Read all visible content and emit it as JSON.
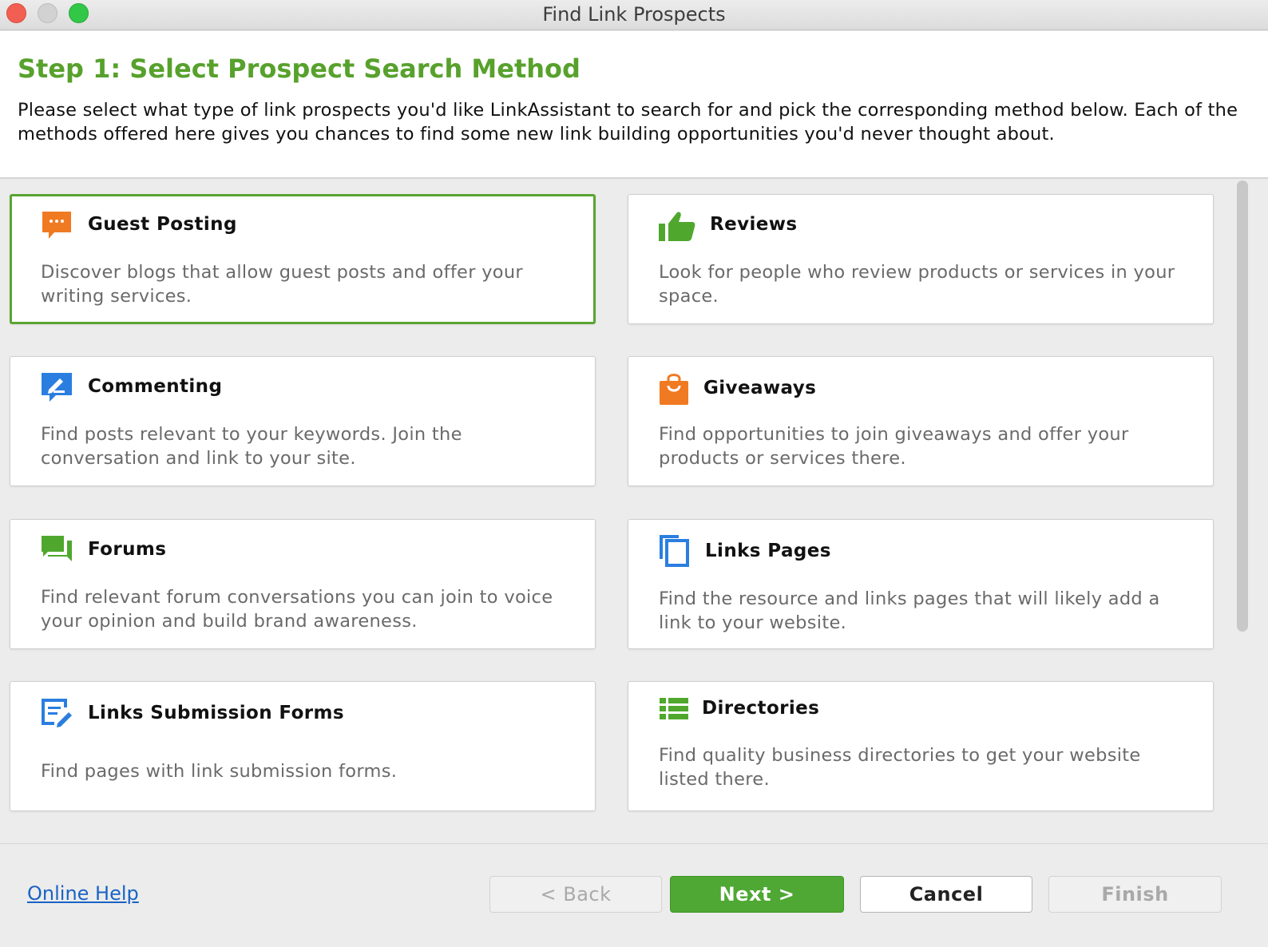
{
  "window": {
    "title": "Find Link Prospects"
  },
  "header": {
    "step_title": "Step 1: Select Prospect Search Method",
    "description": "Please select what type of link prospects you'd like LinkAssistant to search for and pick the corresponding method below. Each of the methods offered here gives you chances to find some new link building opportunities you'd never thought about."
  },
  "methods": [
    {
      "title": "Guest Posting",
      "description": "Discover blogs that allow guest posts and offer your writing services.",
      "icon": "speech-bubble-icon",
      "color": "#f07a22",
      "selected": true
    },
    {
      "title": "Reviews",
      "description": "Look for people who review products or services in your space.",
      "icon": "thumbs-up-icon",
      "color": "#4fa82d",
      "selected": false
    },
    {
      "title": "Commenting",
      "description": "Find posts relevant to your keywords. Join the conversation and link to your site.",
      "icon": "comment-pencil-icon",
      "color": "#2a7ee0",
      "selected": false
    },
    {
      "title": "Giveaways",
      "description": "Find opportunities to join giveaways and offer your products or services there.",
      "icon": "shopping-bag-icon",
      "color": "#f07a22",
      "selected": false
    },
    {
      "title": "Forums",
      "description": "Find relevant forum conversations you can join to voice your opinion and build brand awareness.",
      "icon": "forum-bubbles-icon",
      "color": "#4fa82d",
      "selected": false
    },
    {
      "title": "Links Pages",
      "description": "Find the resource and links pages that will likely add a link to your website.",
      "icon": "copy-pages-icon",
      "color": "#2a7ee0",
      "selected": false
    },
    {
      "title": "Links Submission Forms",
      "description": "Find pages with link submission forms.",
      "icon": "form-edit-icon",
      "color": "#2a7ee0",
      "selected": false
    },
    {
      "title": "Directories",
      "description": "Find quality business directories to get your website listed there.",
      "icon": "list-icon",
      "color": "#4fa82d",
      "selected": false
    }
  ],
  "footer": {
    "help_link": "Online Help",
    "back_label": "< Back",
    "next_label": "Next >",
    "cancel_label": "Cancel",
    "finish_label": "Finish"
  },
  "colors": {
    "accent_green": "#57a12c",
    "link_blue": "#1a63c4"
  }
}
